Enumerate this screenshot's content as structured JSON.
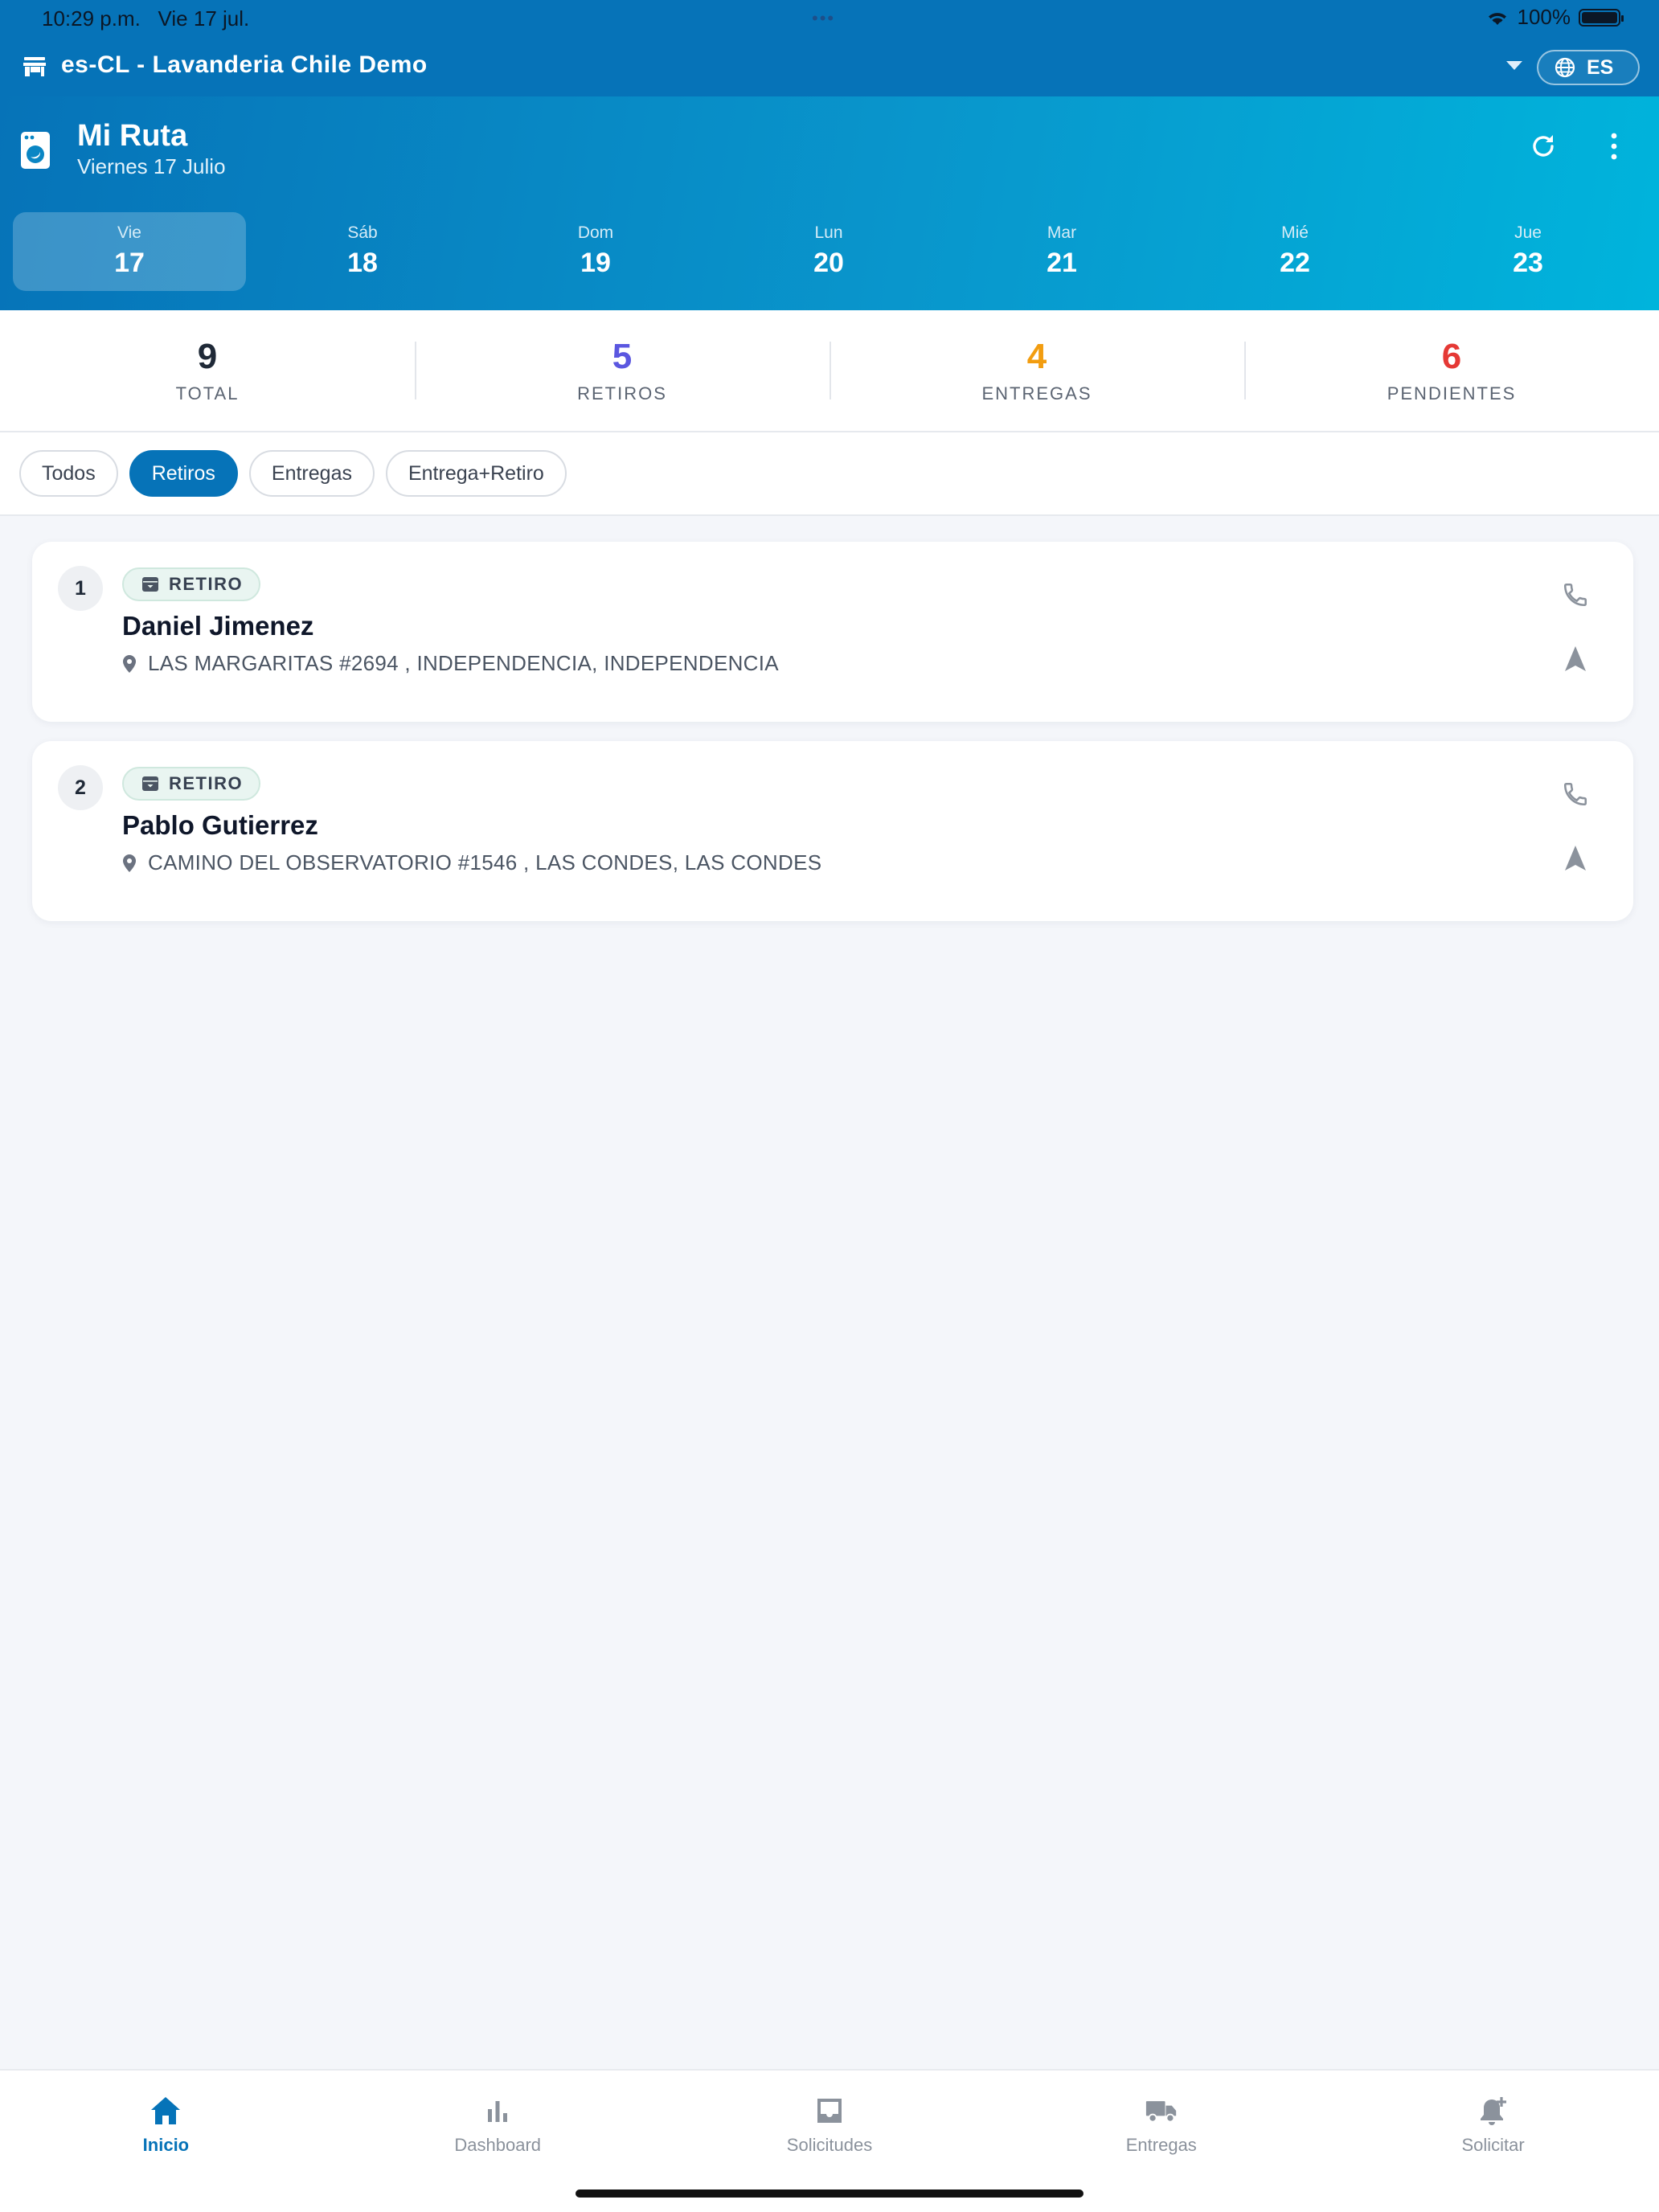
{
  "status_bar": {
    "time": "10:29 p.m.",
    "date": "Vie 17 jul.",
    "battery": "100%",
    "dots": "•••"
  },
  "app_bar": {
    "store_name": "es-CL - Lavanderia Chile Demo",
    "language": "ES"
  },
  "header": {
    "title": "Mi Ruta",
    "subtitle": "Viernes 17 Julio"
  },
  "days": [
    {
      "name": "Vie",
      "number": "17"
    },
    {
      "name": "Sáb",
      "number": "18"
    },
    {
      "name": "Dom",
      "number": "19"
    },
    {
      "name": "Lun",
      "number": "20"
    },
    {
      "name": "Mar",
      "number": "21"
    },
    {
      "name": "Mié",
      "number": "22"
    },
    {
      "name": "Jue",
      "number": "23"
    }
  ],
  "stats": [
    {
      "value": "9",
      "label": "TOTAL",
      "color": "#1f2937"
    },
    {
      "value": "5",
      "label": "RETIROS",
      "color": "#5b57e0"
    },
    {
      "value": "4",
      "label": "ENTREGAS",
      "color": "#f29d10"
    },
    {
      "value": "6",
      "label": "PENDIENTES",
      "color": "#e53935"
    }
  ],
  "filters": [
    "Todos",
    "Retiros",
    "Entregas",
    "Entrega+Retiro"
  ],
  "active_filter": "Retiros",
  "stops": [
    {
      "index": "1",
      "type": "RETIRO",
      "name": "Daniel Jimenez",
      "address": "LAS MARGARITAS #2694 , INDEPENDENCIA, INDEPENDENCIA"
    },
    {
      "index": "2",
      "type": "RETIRO",
      "name": "Pablo Gutierrez",
      "address": "CAMINO DEL OBSERVATORIO #1546 , LAS CONDES, LAS CONDES"
    }
  ],
  "tabs": [
    {
      "label": "Inicio",
      "icon": "home-icon"
    },
    {
      "label": "Dashboard",
      "icon": "bar-chart-icon"
    },
    {
      "label": "Solicitudes",
      "icon": "inbox-icon"
    },
    {
      "label": "Entregas",
      "icon": "truck-icon"
    },
    {
      "label": "Solicitar",
      "icon": "bell-plus-icon"
    }
  ],
  "active_tab": "Inicio",
  "colors": {
    "primary": "#0673b8",
    "accent": "#00b4dc",
    "background": "#f4f6fa"
  }
}
